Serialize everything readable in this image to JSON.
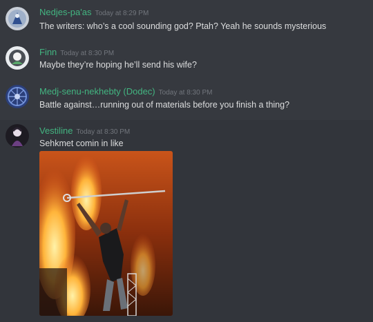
{
  "messages": [
    {
      "username": "Nedjes-pa'as",
      "timestamp": "Today at 8:29 PM",
      "text": "The writers: who’s a cool sounding god? Ptah? Yeah he sounds mysterious"
    },
    {
      "username": "Finn",
      "timestamp": "Today at 8:30 PM",
      "text": "Maybe they’re hoping he’ll send his wife?"
    },
    {
      "username": "Medj-senu-nekhebty (Dodec)",
      "timestamp": "Today at 8:30 PM",
      "text": "Battle against…running out of materials before you finish a thing?"
    },
    {
      "username": "Vestiline",
      "timestamp": "Today at 8:30 PM",
      "text": "Sehkmet comin in like"
    }
  ],
  "colors": {
    "background": "#36393f",
    "username": "#43b581",
    "timestamp": "#72767d",
    "message_text": "#dcddde"
  }
}
